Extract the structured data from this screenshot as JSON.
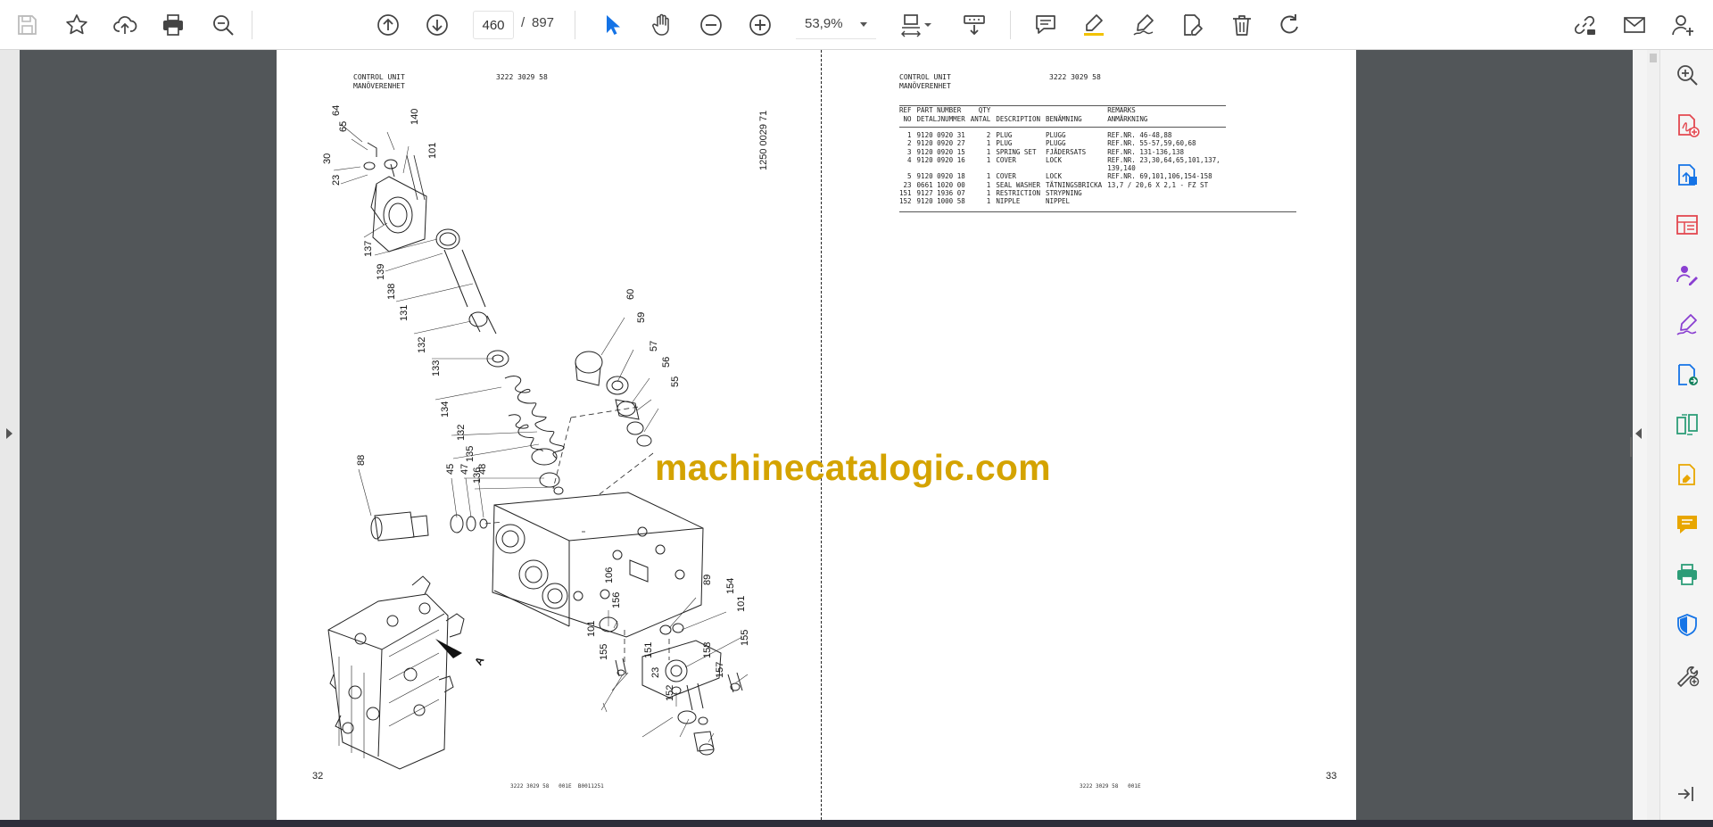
{
  "toolbar": {
    "icons": [
      "save-icon",
      "star-icon",
      "cloud-upload-icon",
      "print-icon",
      "zoom-search-icon",
      "previous-page-icon",
      "next-page-icon",
      "select-arrow-icon",
      "hand-tool-icon",
      "zoom-out-icon",
      "zoom-in-icon",
      "fit-page-icon",
      "scroll-mode-icon",
      "comment-icon",
      "highlight-icon",
      "sign-icon",
      "edit-pdf-icon",
      "delete-icon",
      "rotate-icon",
      "share-link-icon",
      "email-icon",
      "account-icon"
    ],
    "current_page": "460",
    "slash": "/",
    "total_pages": "897",
    "zoom": "53,9%",
    "accent": "#1473e6"
  },
  "document": {
    "left_page": {
      "header_title": "CONTROL UNIT",
      "header_subtitle": "MANÖVERENHET",
      "header_code": "3222 3029 58",
      "drawing_number": "1250 0029 71",
      "page_number": "32",
      "footer": "3222 3029 58   001E  B0011251",
      "view_label": "A",
      "callouts": [
        "64",
        "65",
        "140",
        "101",
        "30",
        "23",
        "137",
        "139",
        "138",
        "131",
        "132",
        "133",
        "134",
        "132",
        "135",
        "136",
        "88",
        "45",
        "47",
        "48",
        "60",
        "59",
        "57",
        "56",
        "55",
        "106",
        "156",
        "89",
        "154",
        "101",
        "155",
        "101",
        "155",
        "151",
        "158",
        "23",
        "157",
        "152"
      ]
    },
    "right_page": {
      "header_title": "CONTROL UNIT",
      "header_subtitle": "MANÖVERENHET",
      "header_code": "3222 3029 58",
      "page_number": "33",
      "footer": "3222 3029 58   001E",
      "table": {
        "columns": [
          {
            "en": "REF",
            "sv": "NO"
          },
          {
            "en": "PART NUMBER",
            "sv": "DETALJNUMMER"
          },
          {
            "en": "QTY",
            "sv": "ANTAL"
          },
          {
            "en": "DESCRIPTION",
            "sv": ""
          },
          {
            "en": "BENÄMNING",
            "sv": ""
          },
          {
            "en": "REMARKS",
            "sv": "ANMÄRKNING"
          }
        ],
        "rows": [
          {
            "ref": "1",
            "part": "9120 0920 31",
            "qty": "2",
            "desc": "PLUG",
            "ben": "PLUGG",
            "remarks": "REF.NR. 46-48,88"
          },
          {
            "ref": "2",
            "part": "9120 0920 27",
            "qty": "1",
            "desc": "PLUG",
            "ben": "PLUGG",
            "remarks": "REF.NR. 55-57,59,60,68"
          },
          {
            "ref": "3",
            "part": "9120 0920 15",
            "qty": "1",
            "desc": "SPRING SET",
            "ben": "FJÄDERSATS",
            "remarks": "REF.NR. 131-136,138"
          },
          {
            "ref": "4",
            "part": "9120 0920 16",
            "qty": "1",
            "desc": "COVER",
            "ben": "LOCK",
            "remarks": "REF.NR. 23,30,64,65,101,137,"
          },
          {
            "ref": "",
            "part": "",
            "qty": "",
            "desc": "",
            "ben": "",
            "remarks": "139,140"
          },
          {
            "ref": "5",
            "part": "9120 0920 18",
            "qty": "1",
            "desc": "COVER",
            "ben": "LOCK",
            "remarks": "REF.NR. 69,101,106,154-158"
          },
          {
            "ref": "23",
            "part": "0661 1020 00",
            "qty": "1",
            "desc": "SEAL WASHER",
            "ben": "TÄTNINGSBRICKA",
            "remarks": "13,7 / 20,6 X 2,1 - FZ ST"
          },
          {
            "ref": "151",
            "part": "9127 1936 07",
            "qty": "1",
            "desc": "RESTRICTION",
            "ben": "STRYPNING",
            "remarks": ""
          },
          {
            "ref": "152",
            "part": "9120 1000 58",
            "qty": "1",
            "desc": "NIPPLE",
            "ben": "NIPPEL",
            "remarks": ""
          }
        ]
      }
    },
    "watermark": "machinecatalogic.com",
    "watermark_color": "#d4a300"
  },
  "tools_panel": {
    "icons": [
      "zoom-in-panel-icon",
      "create-pdf-icon",
      "export-pdf-icon",
      "organize-pages-icon",
      "request-signatures-icon",
      "fill-sign-icon",
      "export-pdf-arrow-icon",
      "compare-files-icon",
      "edit-pdf-panel-icon",
      "comment-panel-icon",
      "print-production-icon",
      "protect-icon",
      "more-tools-icon",
      "collapse-panel-icon"
    ],
    "colors": {
      "red": "#e34850",
      "blue": "#1473e6",
      "purple": "#8a3fd1",
      "teal": "#12805c",
      "yellow": "#e8a600",
      "green": "#2d9d78",
      "dark": "#4b4b4b"
    }
  }
}
